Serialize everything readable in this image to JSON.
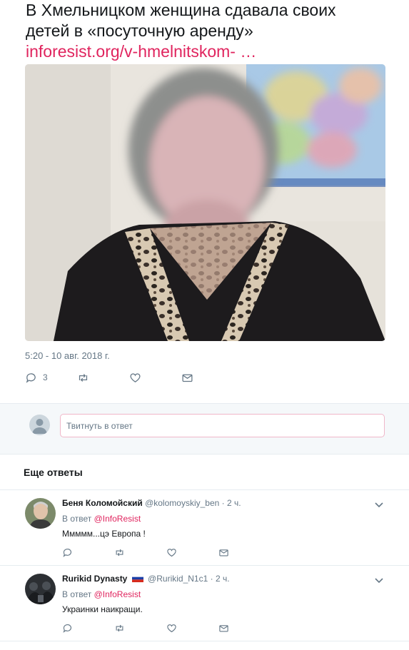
{
  "tweet": {
    "text_line1": "В Хмельницком женщина сдавала своих",
    "text_line2": "детей в «посуточную аренду»",
    "link": "inforesist.org/v-hmelnitskom-  …",
    "timestamp": "5:20 - 10 авг. 2018 г.",
    "replies_count": "3",
    "icons": [
      "reply-icon",
      "retweet-icon",
      "like-icon",
      "message-icon"
    ]
  },
  "reply_box": {
    "placeholder": "Твитнуть в ответ"
  },
  "more_replies": {
    "title": "Еще ответы",
    "items": [
      {
        "name": "Беня Коломойский",
        "handle": "@kolomoyskiy_ben",
        "separator": "·",
        "time": "2 ч.",
        "replying_prefix": "В ответ",
        "replying_to": "@InfoResist",
        "text": "Ммммм...цэ Европа !"
      },
      {
        "name": "Rurikid Dynasty",
        "handle": "@Rurikid_N1c1",
        "separator": "·",
        "time": "2 ч.",
        "replying_prefix": "В ответ",
        "replying_to": "@InfoResist",
        "text": "Украинки наикращи."
      }
    ]
  },
  "colors": {
    "accent": "#e0245e",
    "muted": "#657786",
    "text": "#14171a",
    "divider": "#e6ecf0"
  }
}
